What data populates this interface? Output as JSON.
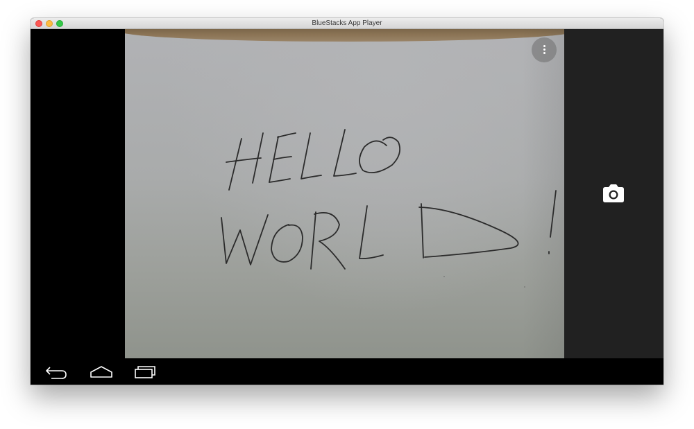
{
  "window": {
    "title": "BlueStacks App Player"
  },
  "camera": {
    "preview_text": [
      "HELLO",
      "WORLD!"
    ],
    "overflow_menu_icon": "more-vert-icon",
    "shutter_icon": "camera-icon"
  },
  "navbar": {
    "buttons": [
      {
        "name": "back",
        "icon": "back-icon"
      },
      {
        "name": "home",
        "icon": "home-icon"
      },
      {
        "name": "recents",
        "icon": "recents-icon"
      }
    ]
  },
  "colors": {
    "side_panel": "#212121",
    "navbar": "#000000",
    "close": "#fc5753",
    "minimize": "#fdbc40",
    "maximize": "#33c748"
  }
}
